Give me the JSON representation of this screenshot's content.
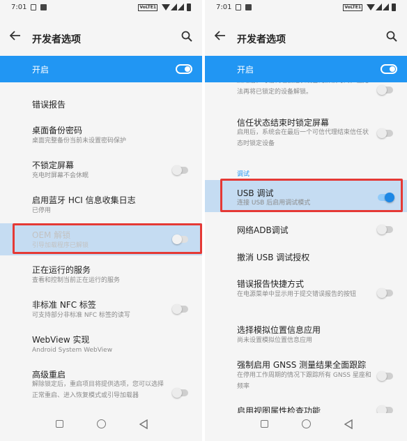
{
  "status": {
    "time": "7:01",
    "network": "VoLTE1"
  },
  "left": {
    "title": "开发者选项",
    "master_label": "开启",
    "items": [
      {
        "title": "错误报告",
        "subtitle": ""
      },
      {
        "title": "桌面备份密码",
        "subtitle": "桌面完整备份当前未设置密码保护"
      },
      {
        "title": "不锁定屏幕",
        "subtitle": "充电时屏幕不会休眠"
      },
      {
        "title": "启用蓝牙 HCI 信息收集日志",
        "subtitle": "已停用"
      },
      {
        "title": "OEM 解锁",
        "subtitle": "引导加载程序已解锁"
      },
      {
        "title": "正在运行的服务",
        "subtitle": "查看和控制当前正在运行的服务"
      },
      {
        "title": "非标准 NFC 标签",
        "subtitle": "可支持部分非标准 NFC 标签的读写"
      },
      {
        "title": "WebView 实现",
        "subtitle": "Android System WebView"
      },
      {
        "title": "高级重启",
        "subtitle": "解除锁定后，重启项目将提供选项，您可以选择正常重启、进入恢复模式或引导加载器"
      }
    ]
  },
  "right": {
    "title": "开发者选项",
    "master_label": "开启",
    "partial_subtitle": "启用后，可信代理会延长设备的解锁时间，但无法再将已锁定的设备解锁。",
    "section_debug": "调试",
    "items": [
      {
        "title": "信任状态结束时锁定屏幕",
        "subtitle": "启用后，系统会在最后一个可信代理结束信任状态时锁定设备"
      },
      {
        "title": "USB 调试",
        "subtitle": "连接 USB 后启用调试模式"
      },
      {
        "title": "网络ADB调试",
        "subtitle": ""
      },
      {
        "title": "撤消 USB 调试授权",
        "subtitle": ""
      },
      {
        "title": "错误报告快捷方式",
        "subtitle": "在电源菜单中显示用于提交错误报告的按钮"
      },
      {
        "title": "选择模拟位置信息应用",
        "subtitle": "尚未设置模拟位置信息应用"
      },
      {
        "title": "强制启用 GNSS 测量结果全面跟踪",
        "subtitle": "在停用工作周期的情况下跟踪所有 GNSS 星座和频率"
      },
      {
        "title": "启用视图属性检查功能",
        "subtitle": ""
      }
    ]
  },
  "colors": {
    "accent": "#2196f3",
    "highlight": "#c5dcf2",
    "annotation": "#e53935"
  }
}
